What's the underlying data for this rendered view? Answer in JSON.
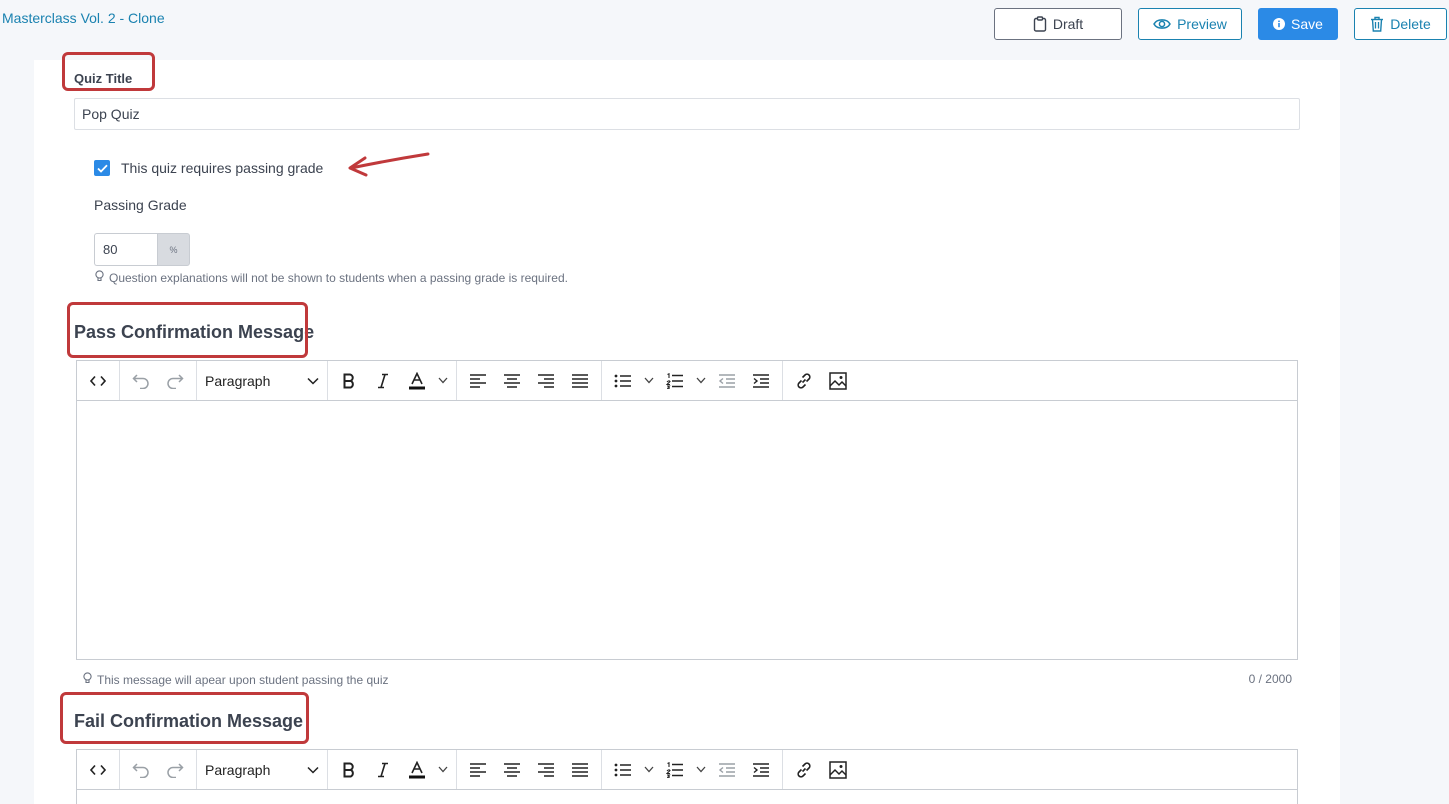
{
  "header": {
    "course_title": "Masterclass Vol. 2 - Clone",
    "buttons": {
      "draft": "Draft",
      "preview": "Preview",
      "save": "Save",
      "delete": "Delete"
    }
  },
  "quiz": {
    "title_label": "Quiz Title",
    "title_value": "Pop Quiz",
    "passing_grade_checkbox": {
      "label": "This quiz requires passing grade",
      "checked": true
    },
    "passing_grade_label": "Passing Grade",
    "passing_grade_value": "80",
    "passing_grade_unit": "%",
    "passing_grade_hint": "Question explanations will not be shown to students when a passing grade is required."
  },
  "pass_message": {
    "title": "Pass Confirmation Message",
    "block_format": "Paragraph",
    "content": "",
    "hint": "This message will apear upon student passing the quiz",
    "counter": "0 / 2000"
  },
  "fail_message": {
    "title": "Fail Confirmation Message",
    "block_format": "Paragraph",
    "content": ""
  },
  "icons": {
    "draft": "clipboard-icon",
    "preview": "eye-icon",
    "save": "info-icon",
    "delete": "trash-icon",
    "hint": "lightbulb-icon"
  },
  "colors": {
    "accent": "#1a82b0",
    "primary": "#2b8ae6",
    "annotation": "#c0393b"
  }
}
